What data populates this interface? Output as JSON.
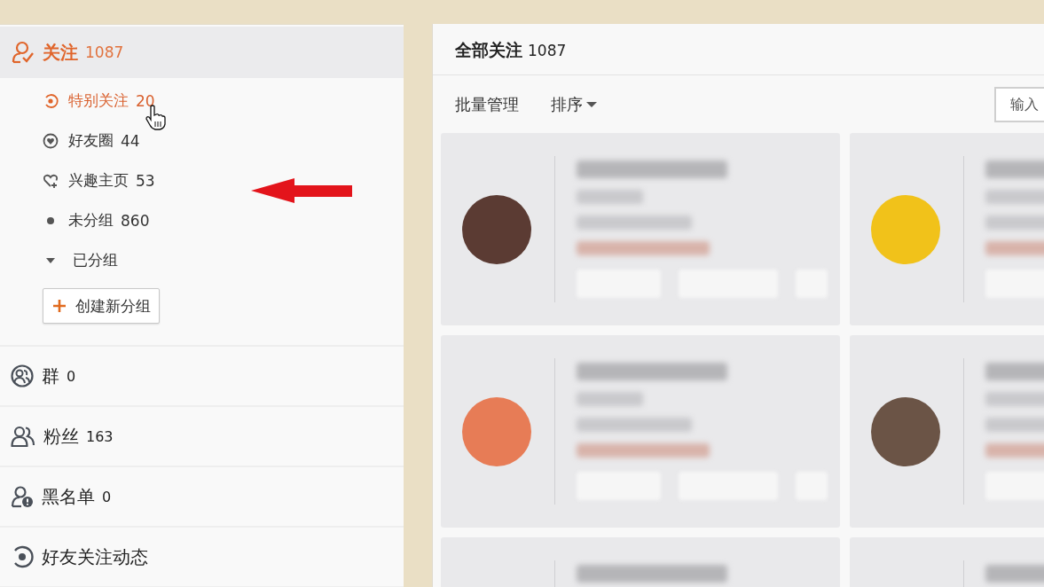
{
  "sidebar": {
    "follow": {
      "label": "关注",
      "count": "1087",
      "selected": true,
      "children": [
        {
          "kind": "item",
          "label": "特别关注",
          "count": "20",
          "selected": true
        },
        {
          "kind": "item",
          "label": "好友圈",
          "count": "44",
          "selected": false
        },
        {
          "kind": "item",
          "label": "兴趣主页",
          "count": "53",
          "selected": false
        },
        {
          "kind": "item",
          "label": "未分组",
          "count": "860",
          "selected": false
        },
        {
          "kind": "folder",
          "label": "已分组",
          "expanded": true,
          "selected": false
        }
      ],
      "create_button": "创建新分组"
    },
    "sections": [
      {
        "label": "群",
        "count": "0",
        "selected": false
      },
      {
        "label": "粉丝",
        "count": "163",
        "selected": false
      },
      {
        "label": "黑名单",
        "count": "0",
        "selected": false
      },
      {
        "label": "好友关注动态",
        "selected": false
      }
    ]
  },
  "main": {
    "title": "全部关注",
    "count": "1087",
    "toolbar": {
      "batch": "批量管理",
      "sort": "排序",
      "search": {
        "placeholder": "输入"
      }
    }
  }
}
